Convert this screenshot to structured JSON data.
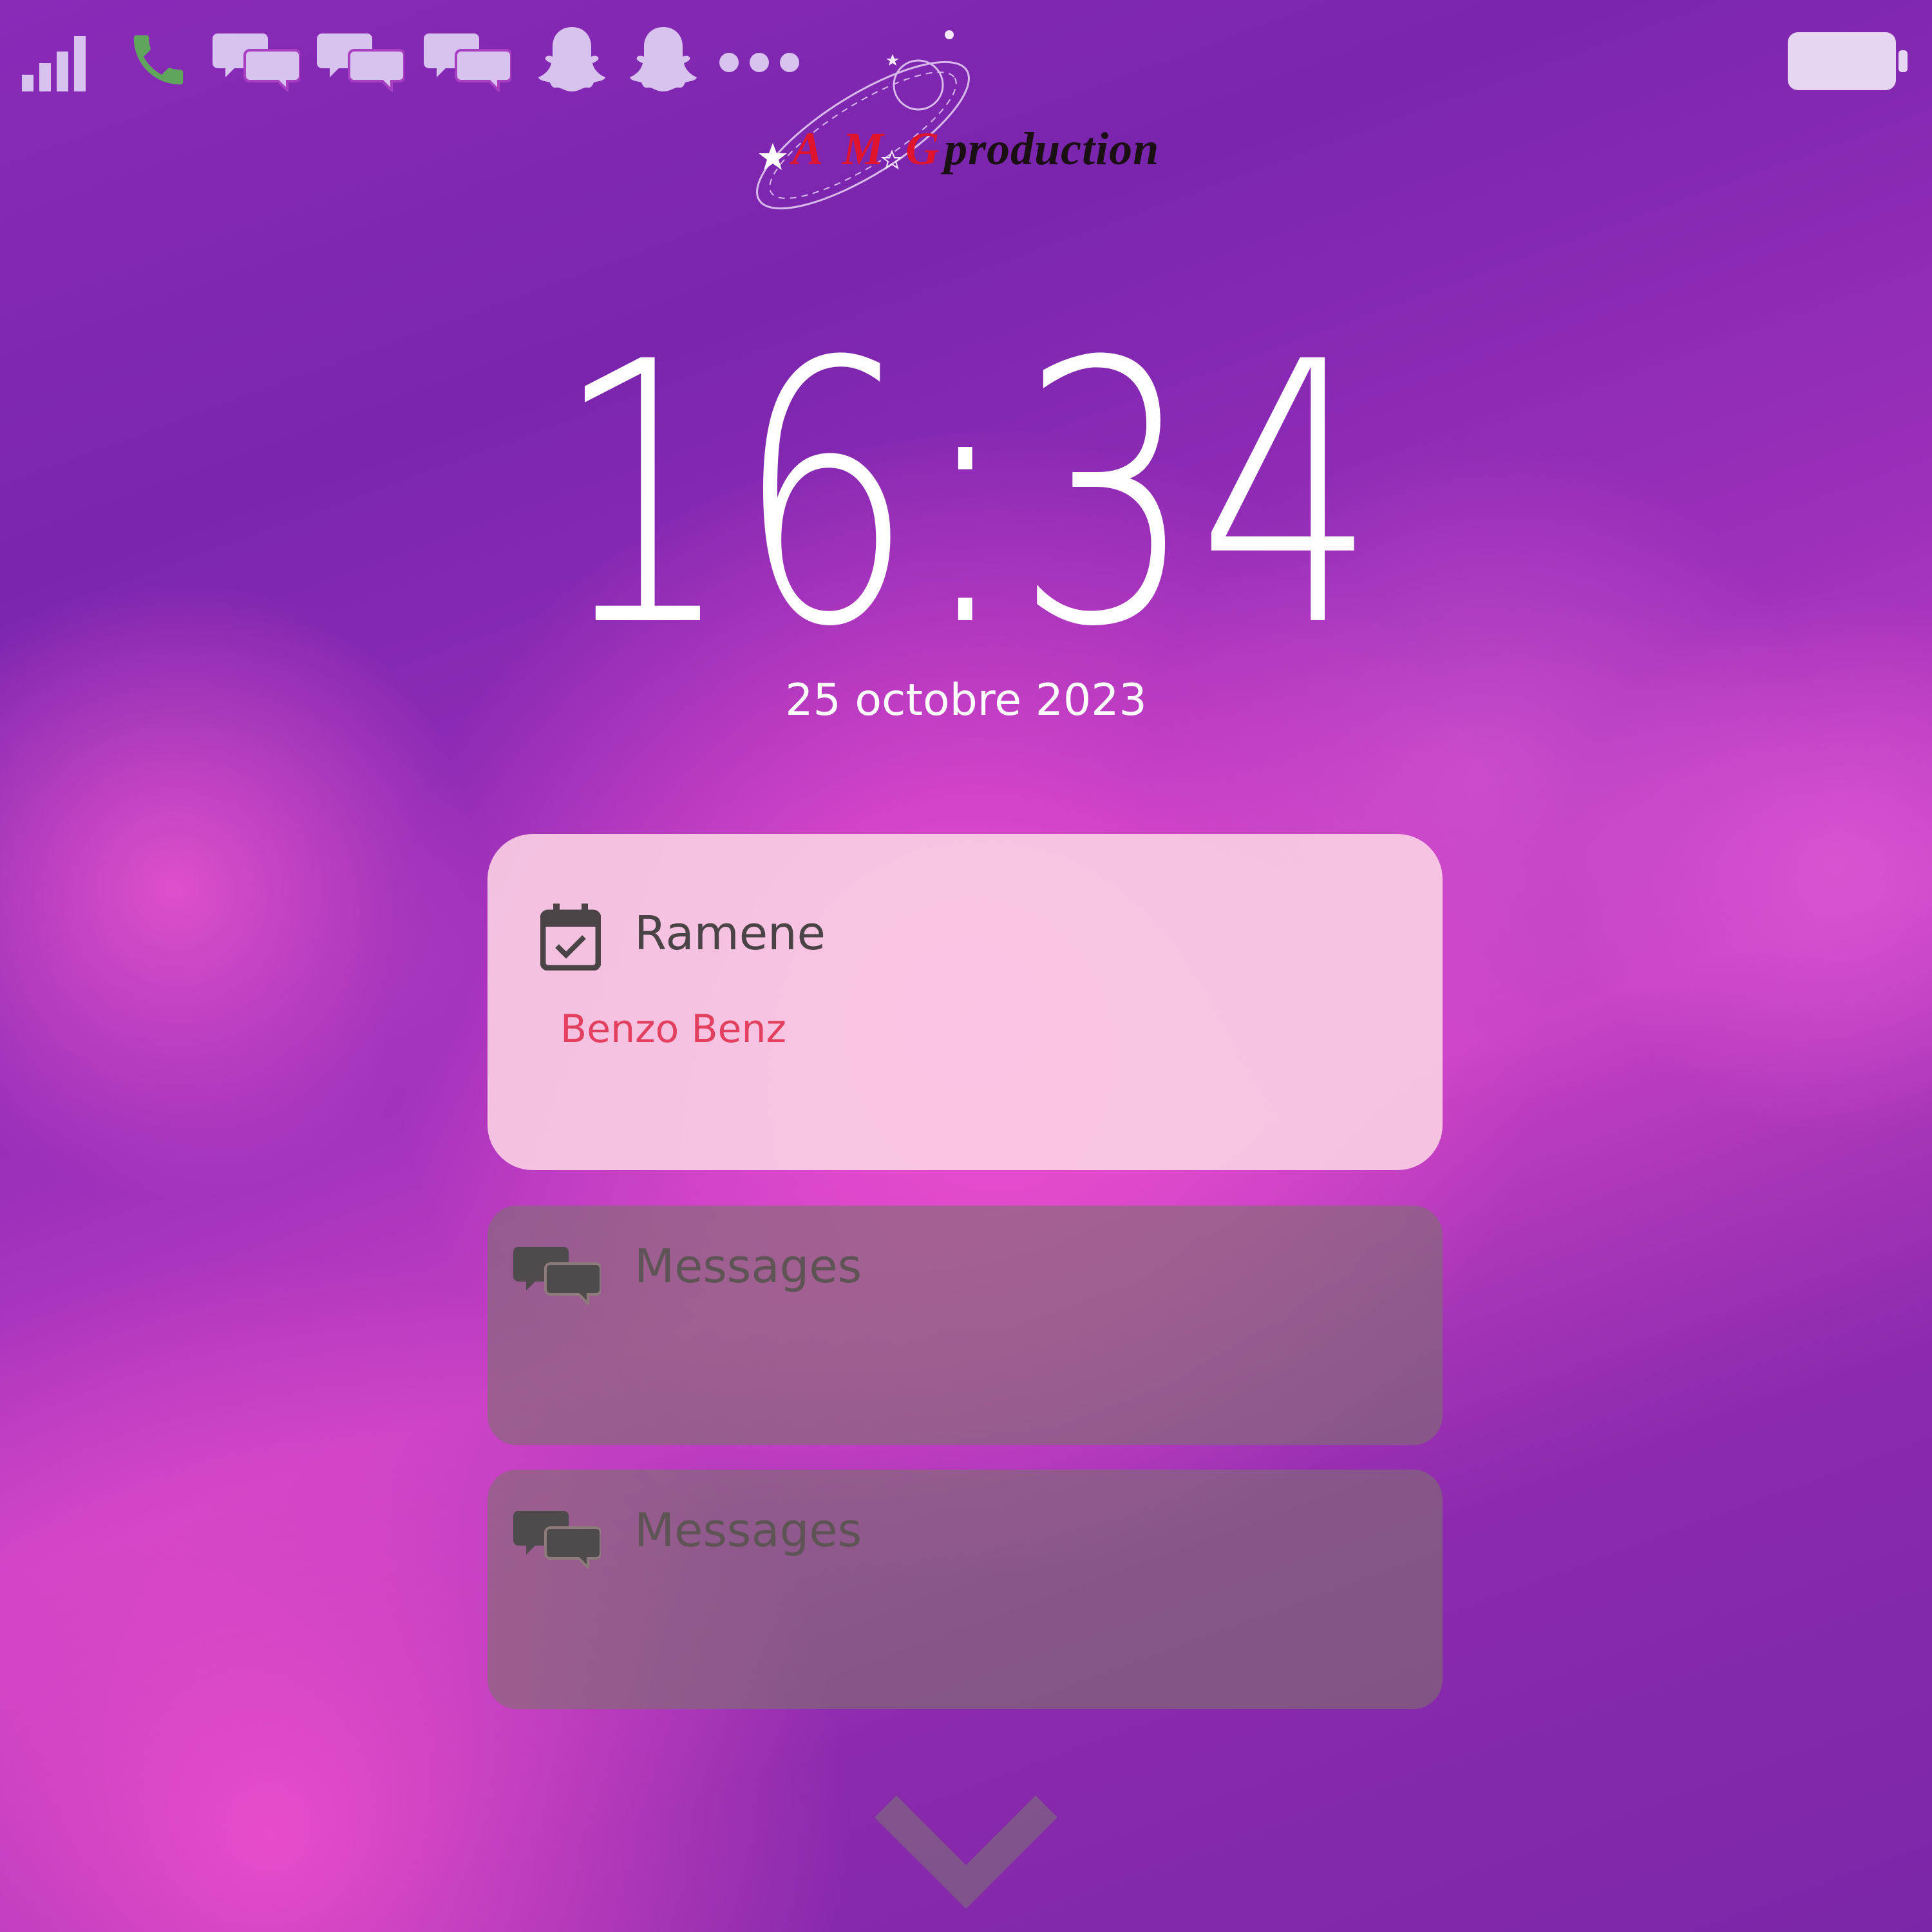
{
  "status_bar": {
    "icons": [
      "signal-icon",
      "phone-icon",
      "messages-icon",
      "messages-icon",
      "messages-icon",
      "snapchat-icon",
      "snapchat-icon",
      "more-icon",
      "battery-icon"
    ],
    "colors": {
      "icon": "#d8c2ee",
      "phone": "#5fa65c"
    }
  },
  "logo": {
    "amg": "A M G",
    "production": "production"
  },
  "lock": {
    "time": "16:34",
    "date": "25 octobre 2023"
  },
  "notifications": [
    {
      "icon": "calendar-check-icon",
      "title": "Ramene",
      "subtitle": "Benzo Benz"
    },
    {
      "icon": "messages-icon",
      "title": "Messages"
    },
    {
      "icon": "messages-icon",
      "title": "Messages"
    }
  ],
  "footer": {
    "icon": "chevron-down-icon"
  },
  "colors": {
    "subtitle": "#e2405e",
    "card_primary": "#fcd0e4",
    "card_muted": "#807070"
  }
}
